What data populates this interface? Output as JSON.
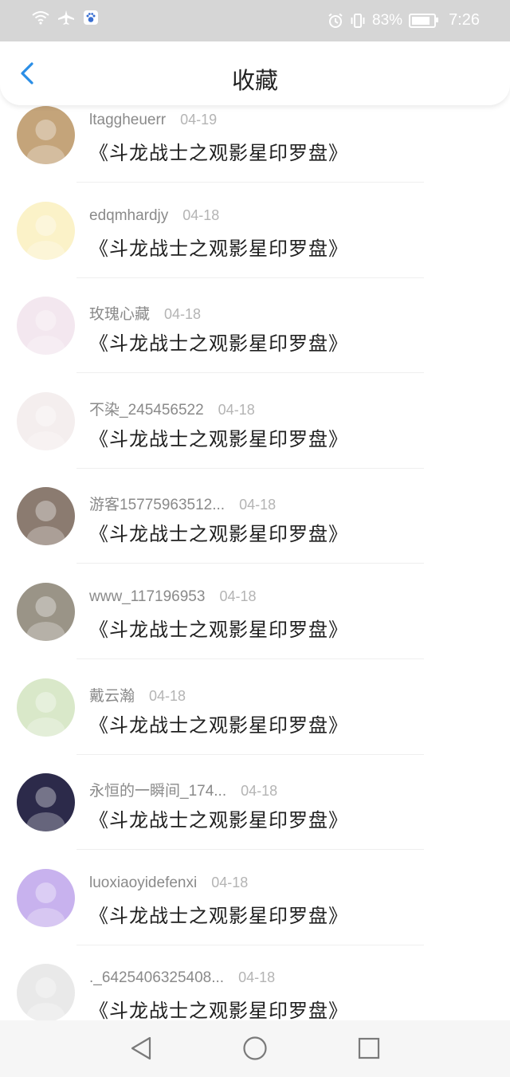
{
  "status_bar": {
    "battery": "83%",
    "battery_level": 0.83,
    "time": "7:26",
    "left_icons": [
      "wifi-icon",
      "airplane-icon",
      "paw-app-icon"
    ],
    "right_icons": [
      "alarm-icon",
      "vibrate-icon",
      "battery-icon"
    ]
  },
  "header": {
    "title": "收藏",
    "back_icon": "chevron-left-icon",
    "accent": "#2a8ee6"
  },
  "items": [
    {
      "username": "ltaggheuerr",
      "date": "04-19",
      "book": "《斗龙战士之观影星印罗盘》",
      "avatar_bg": "#c4a47a"
    },
    {
      "username": "edqmhardjy",
      "date": "04-18",
      "book": "《斗龙战士之观影星印罗盘》",
      "avatar_bg": "#fbf2c8"
    },
    {
      "username": "玫瑰心藏",
      "date": "04-18",
      "book": "《斗龙战士之观影星印罗盘》",
      "avatar_bg": "#f3e7ef"
    },
    {
      "username": "不染_245456522",
      "date": "04-18",
      "book": "《斗龙战士之观影星印罗盘》",
      "avatar_bg": "#f4eeee"
    },
    {
      "username": "游客15775963512...",
      "date": "04-18",
      "book": "《斗龙战士之观影星印罗盘》",
      "avatar_bg": "#8b7b70"
    },
    {
      "username": "www_117196953",
      "date": "04-18",
      "book": "《斗龙战士之观影星印罗盘》",
      "avatar_bg": "#9a9487"
    },
    {
      "username": "戴云瀚",
      "date": "04-18",
      "book": "《斗龙战士之观影星印罗盘》",
      "avatar_bg": "#d9e8c9"
    },
    {
      "username": "永恒的一瞬间_174...",
      "date": "04-18",
      "book": "《斗龙战士之观影星印罗盘》",
      "avatar_bg": "#2c2a4a"
    },
    {
      "username": "luoxiaoyidefenxi",
      "date": "04-18",
      "book": "《斗龙战士之观影星印罗盘》",
      "avatar_bg": "#c8b2ee"
    },
    {
      "username": "._6425406325408...",
      "date": "04-18",
      "book": "《斗龙战士之观影星印罗盘》",
      "avatar_bg": "#e9e9e9"
    }
  ],
  "nav": {
    "back": "triangle-back-icon",
    "home": "circle-home-icon",
    "recents": "square-recents-icon"
  }
}
